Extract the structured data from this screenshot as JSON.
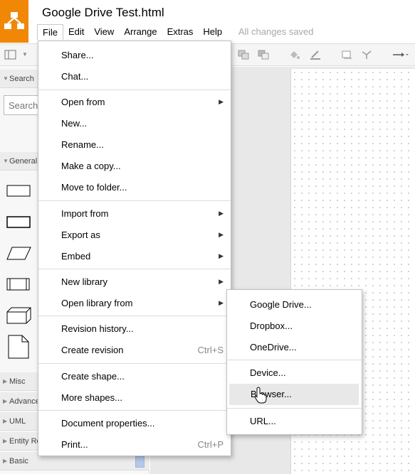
{
  "app": {
    "title": "Google Drive Test.html",
    "save_status": "All changes saved",
    "menubar": [
      "File",
      "Edit",
      "View",
      "Arrange",
      "Extras",
      "Help"
    ],
    "active_menu": "File"
  },
  "sidebar": {
    "search_section": "Search",
    "search_placeholder": "Search",
    "general_section": "General",
    "collapsed_sections": [
      "Misc",
      "Advanced",
      "UML",
      "Entity Relation",
      "Basic"
    ]
  },
  "file_menu": {
    "items": [
      {
        "label": "Share...",
        "shortcut": "",
        "submenu": false
      },
      {
        "label": "Chat...",
        "shortcut": "",
        "submenu": false
      },
      {
        "label": "Open from",
        "shortcut": "",
        "submenu": true
      },
      {
        "label": "New...",
        "shortcut": "",
        "submenu": false
      },
      {
        "label": "Rename...",
        "shortcut": "",
        "submenu": false
      },
      {
        "label": "Make a copy...",
        "shortcut": "",
        "submenu": false
      },
      {
        "label": "Move to folder...",
        "shortcut": "",
        "submenu": false
      },
      {
        "label": "Import from",
        "shortcut": "",
        "submenu": true
      },
      {
        "label": "Export as",
        "shortcut": "",
        "submenu": true
      },
      {
        "label": "Embed",
        "shortcut": "",
        "submenu": true
      },
      {
        "label": "New library",
        "shortcut": "",
        "submenu": true
      },
      {
        "label": "Open library from",
        "shortcut": "",
        "submenu": true
      },
      {
        "label": "Revision history...",
        "shortcut": "",
        "submenu": false
      },
      {
        "label": "Create revision",
        "shortcut": "Ctrl+S",
        "submenu": false
      },
      {
        "label": "Create shape...",
        "shortcut": "",
        "submenu": false
      },
      {
        "label": "More shapes...",
        "shortcut": "",
        "submenu": false
      },
      {
        "label": "Document properties...",
        "shortcut": "",
        "submenu": false
      },
      {
        "label": "Print...",
        "shortcut": "Ctrl+P",
        "submenu": false
      }
    ]
  },
  "open_library_submenu": {
    "items": [
      {
        "label": "Google Drive..."
      },
      {
        "label": "Dropbox..."
      },
      {
        "label": "OneDrive..."
      },
      {
        "label": "Device..."
      },
      {
        "label": "Browser..."
      },
      {
        "label": "URL..."
      }
    ],
    "hovered": "Browser..."
  },
  "toolbar": {
    "icons": [
      "format-panel-icon",
      "to-front-icon",
      "to-back-icon",
      "fill-color-icon",
      "line-color-icon",
      "shadow-icon",
      "waypoints-icon",
      "connection-arrow-icon"
    ]
  },
  "colors": {
    "brand_orange": "#f08705",
    "menu_hover": "#e8e8e8"
  }
}
